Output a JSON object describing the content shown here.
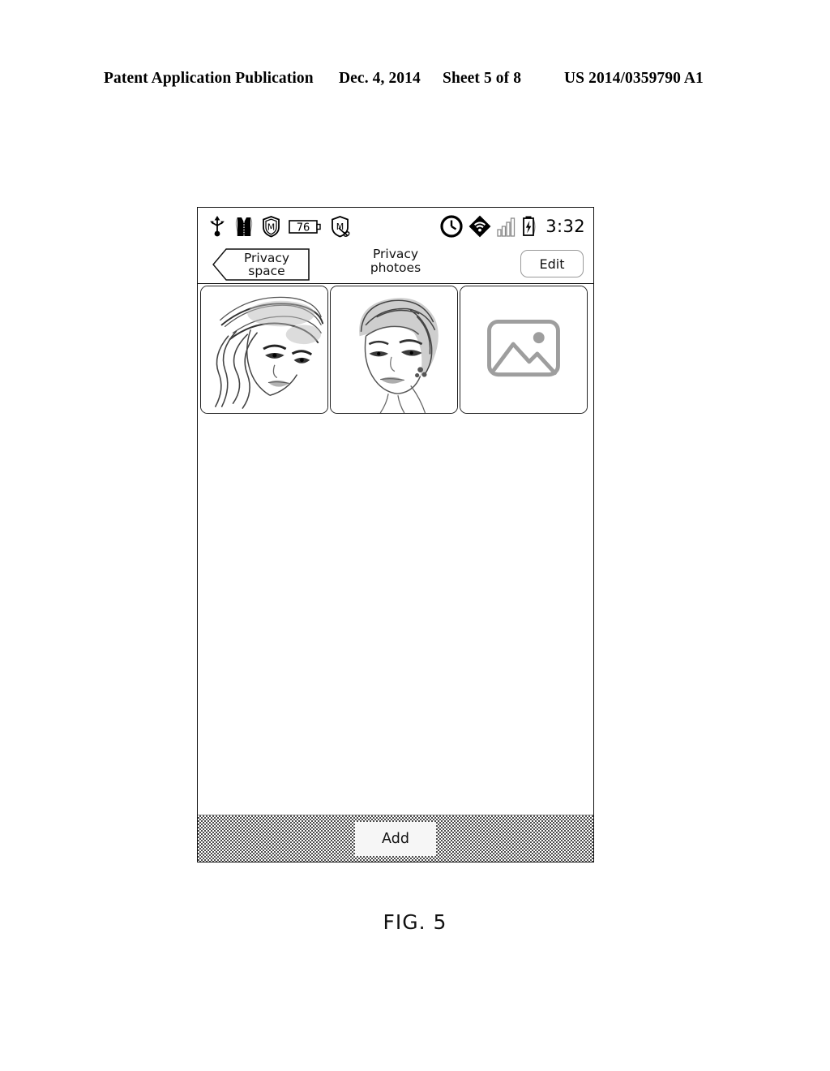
{
  "patent_header": {
    "publication": "Patent Application Publication",
    "date": "Dec. 4, 2014",
    "sheet": "Sheet 5 of 8",
    "number": "US 2014/0359790 A1"
  },
  "figure": {
    "caption": "FIG. 5"
  },
  "phone": {
    "status_bar": {
      "left_icons": [
        {
          "name": "usb-sync-icon",
          "label": "USB sync"
        },
        {
          "name": "vest-garment-icon",
          "label": "Garment"
        },
        {
          "name": "shield-m-icon",
          "label": "Shield M"
        },
        {
          "name": "battery-level-icon",
          "label": "Battery",
          "value": "76"
        },
        {
          "name": "shield-m-slash-icon",
          "label": "Shield M disabled"
        }
      ],
      "right_icons": [
        {
          "name": "alarm-clock-icon",
          "label": "Alarm"
        },
        {
          "name": "wifi-icon",
          "label": "Wi-Fi"
        },
        {
          "name": "signal-bars-icon",
          "label": "Signal"
        },
        {
          "name": "battery-charging-icon",
          "label": "Charging"
        }
      ],
      "time": "3:32",
      "battery_percent": "76"
    },
    "nav_bar": {
      "back_label_line1": "Privacy",
      "back_label_line2": "space",
      "title_line1": "Privacy",
      "title_line2": "photoes",
      "edit_label": "Edit"
    },
    "photo_grid": {
      "items": [
        {
          "name": "photo-thumbnail-1",
          "kind": "portrait-long-hair",
          "alt": "Woman with long wavy hair sketch"
        },
        {
          "name": "photo-thumbnail-2",
          "kind": "portrait-short-hair",
          "alt": "Woman with short hair sketch"
        },
        {
          "name": "photo-placeholder-3",
          "kind": "image-placeholder",
          "alt": "Image placeholder"
        }
      ]
    },
    "bottom_bar": {
      "add_label": "Add"
    }
  }
}
